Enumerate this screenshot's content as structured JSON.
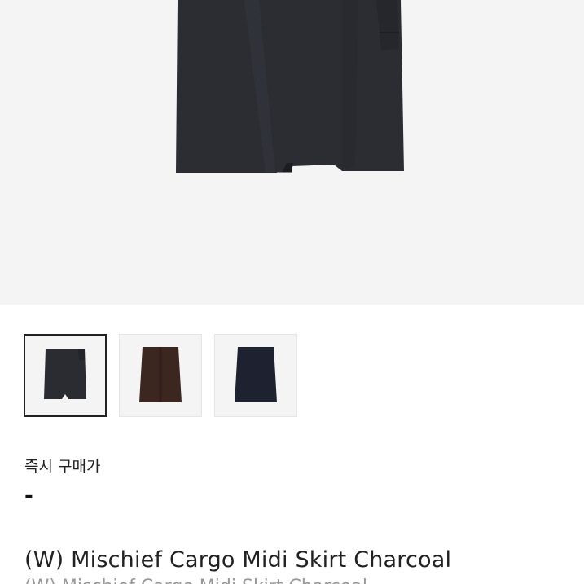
{
  "product": {
    "image_alt": "Mischief Cargo Midi Skirt",
    "thumbnails": [
      {
        "color_name": "charcoal",
        "fill": "#2a2c31",
        "selected": true
      },
      {
        "color_name": "brown",
        "fill": "#3b2620",
        "selected": false
      },
      {
        "color_name": "navy",
        "fill": "#1e2230",
        "selected": false
      }
    ],
    "price_label": "즉시 구매가",
    "price_value": "-",
    "name": "(W) Mischief Cargo Midi Skirt Charcoal",
    "sub_name": "(W) Mischief Cargo Midi Skirt Charcoal"
  },
  "colors": {
    "hero_bg": "#f4f4f4",
    "skirt_main": "#2b2d33",
    "selected_border": "#222222"
  }
}
